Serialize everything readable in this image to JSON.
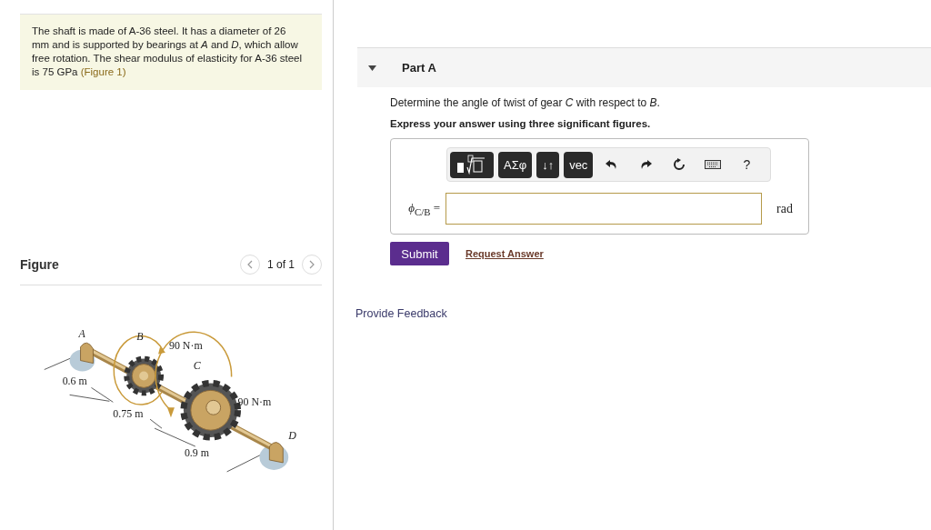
{
  "problem": {
    "text": "The shaft is made of A-36 steel. It has a diameter of 26 mm and is supported by bearings at *A* and *D*, which allow free rotation. The shear modulus of elasticity for A-36 steel is 75 GPa",
    "figure_link": "(Figure 1)"
  },
  "figure": {
    "title": "Figure",
    "pager": "1 of 1",
    "labels": [
      "A",
      "B",
      "90 N·m",
      "C",
      "0.6 m",
      "90 N·m",
      "0.75 m",
      "D",
      "0.9 m"
    ]
  },
  "part": {
    "title": "Part A",
    "expanded": true,
    "question": "Determine the angle of twist of gear *C* with respect to *B*.",
    "instruction": "Express your answer using three significant figures.",
    "toolbar": [
      {
        "kind": "templates"
      },
      {
        "kind": "text",
        "label": "ΑΣφ"
      },
      {
        "kind": "text",
        "label": "↓↑"
      },
      {
        "kind": "text",
        "label": "vec"
      },
      {
        "kind": "undo"
      },
      {
        "kind": "redo"
      },
      {
        "kind": "reset"
      },
      {
        "kind": "keyboard"
      },
      {
        "kind": "help",
        "label": "?"
      }
    ],
    "answer_label": "*ϕ*$_{C/B}$ =",
    "unit": "rad",
    "submit": "Submit",
    "request": "Request Answer"
  },
  "feedback": "Provide Feedback"
}
